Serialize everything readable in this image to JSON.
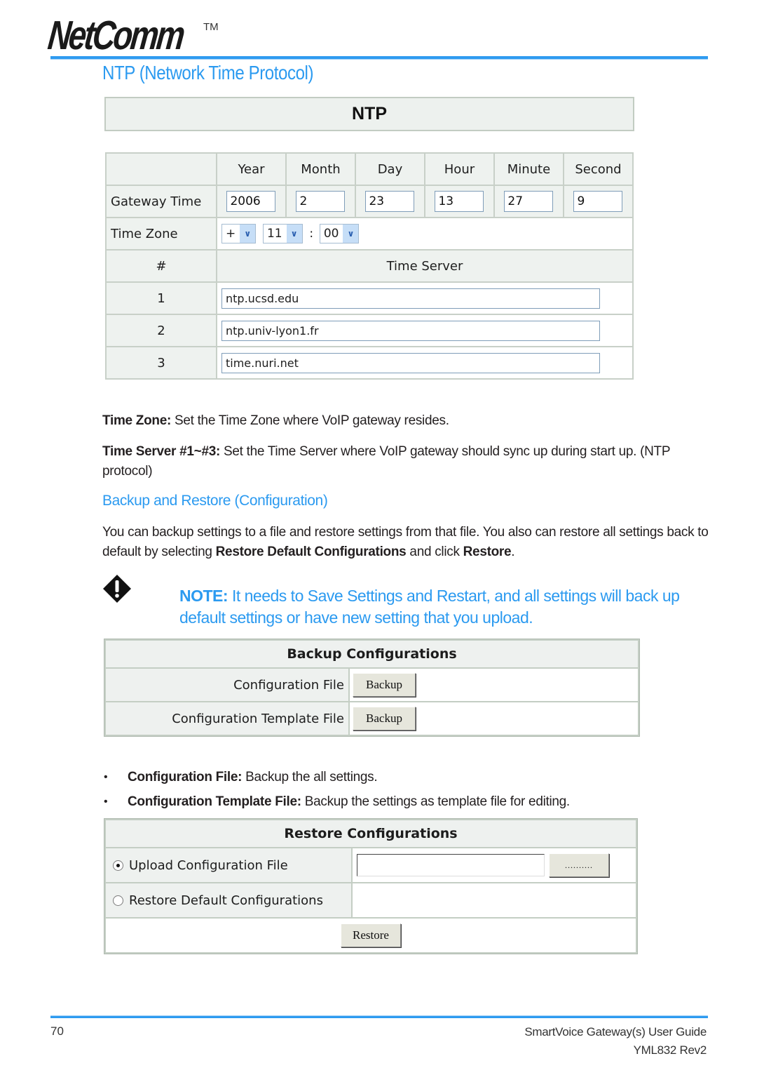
{
  "header": {
    "brand": "NetComm",
    "trademark": "TM",
    "page_title": "NTP (Network Time Protocol)"
  },
  "ntp": {
    "title": "NTP",
    "columns": [
      "",
      "Year",
      "Month",
      "Day",
      "Hour",
      "Minute",
      "Second"
    ],
    "gateway_time": {
      "label": "Gateway Time",
      "values": [
        "2006",
        "2",
        "23",
        "13",
        "27",
        "9"
      ]
    },
    "time_zone": {
      "label": "Time Zone",
      "sign": "+",
      "hours": "11",
      "separator": ":",
      "minutes": "00"
    },
    "servers": {
      "num_header": "#",
      "header": "Time Server",
      "rows": [
        {
          "num": "1",
          "value": "ntp.ucsd.edu"
        },
        {
          "num": "2",
          "value": "ntp.univ-lyon1.fr"
        },
        {
          "num": "3",
          "value": "time.nuri.net"
        }
      ]
    }
  },
  "text": {
    "tz_bold": "Time Zone:",
    "tz_rest": " Set the Time Zone where VoIP gateway resides.",
    "ts_bold": "Time Server #1~#3:",
    "ts_rest": " Set the Time Server where VoIP gateway should sync up during start up. (NTP protocol)",
    "subhead": "Backup and Restore (Configuration)",
    "intro_1": "You can backup settings to a file and restore settings from that file. You also can restore all settings back to default by selecting ",
    "intro_b1": "Restore Default Configurations",
    "intro_2": " and click ",
    "intro_b2": "Restore",
    "intro_3": ".",
    "note_bold": "NOTE:",
    "note_rest": " It needs to Save Settings and Restart, and all settings will back up default settings or have new setting that you upload."
  },
  "backup": {
    "title": "Backup Configurations",
    "rows": [
      {
        "label": "Configuration File",
        "button": "Backup"
      },
      {
        "label": "Configuration Template File",
        "button": "Backup"
      }
    ]
  },
  "bullets": [
    {
      "bold": "Configuration File:",
      "rest": " Backup the all settings."
    },
    {
      "bold": "Configuration Template File:",
      "rest": " Backup the settings as template file for editing."
    }
  ],
  "restore": {
    "title": "Restore Configurations",
    "option_upload": "Upload Configuration File",
    "option_default": "Restore Default Configurations",
    "upload_value": "",
    "browse_label": "..........",
    "restore_label": "Restore",
    "selected": "upload"
  },
  "footer": {
    "page_number": "70",
    "guide_title": "SmartVoice Gateway(s) User Guide",
    "doc_rev": "YML832 Rev2"
  }
}
